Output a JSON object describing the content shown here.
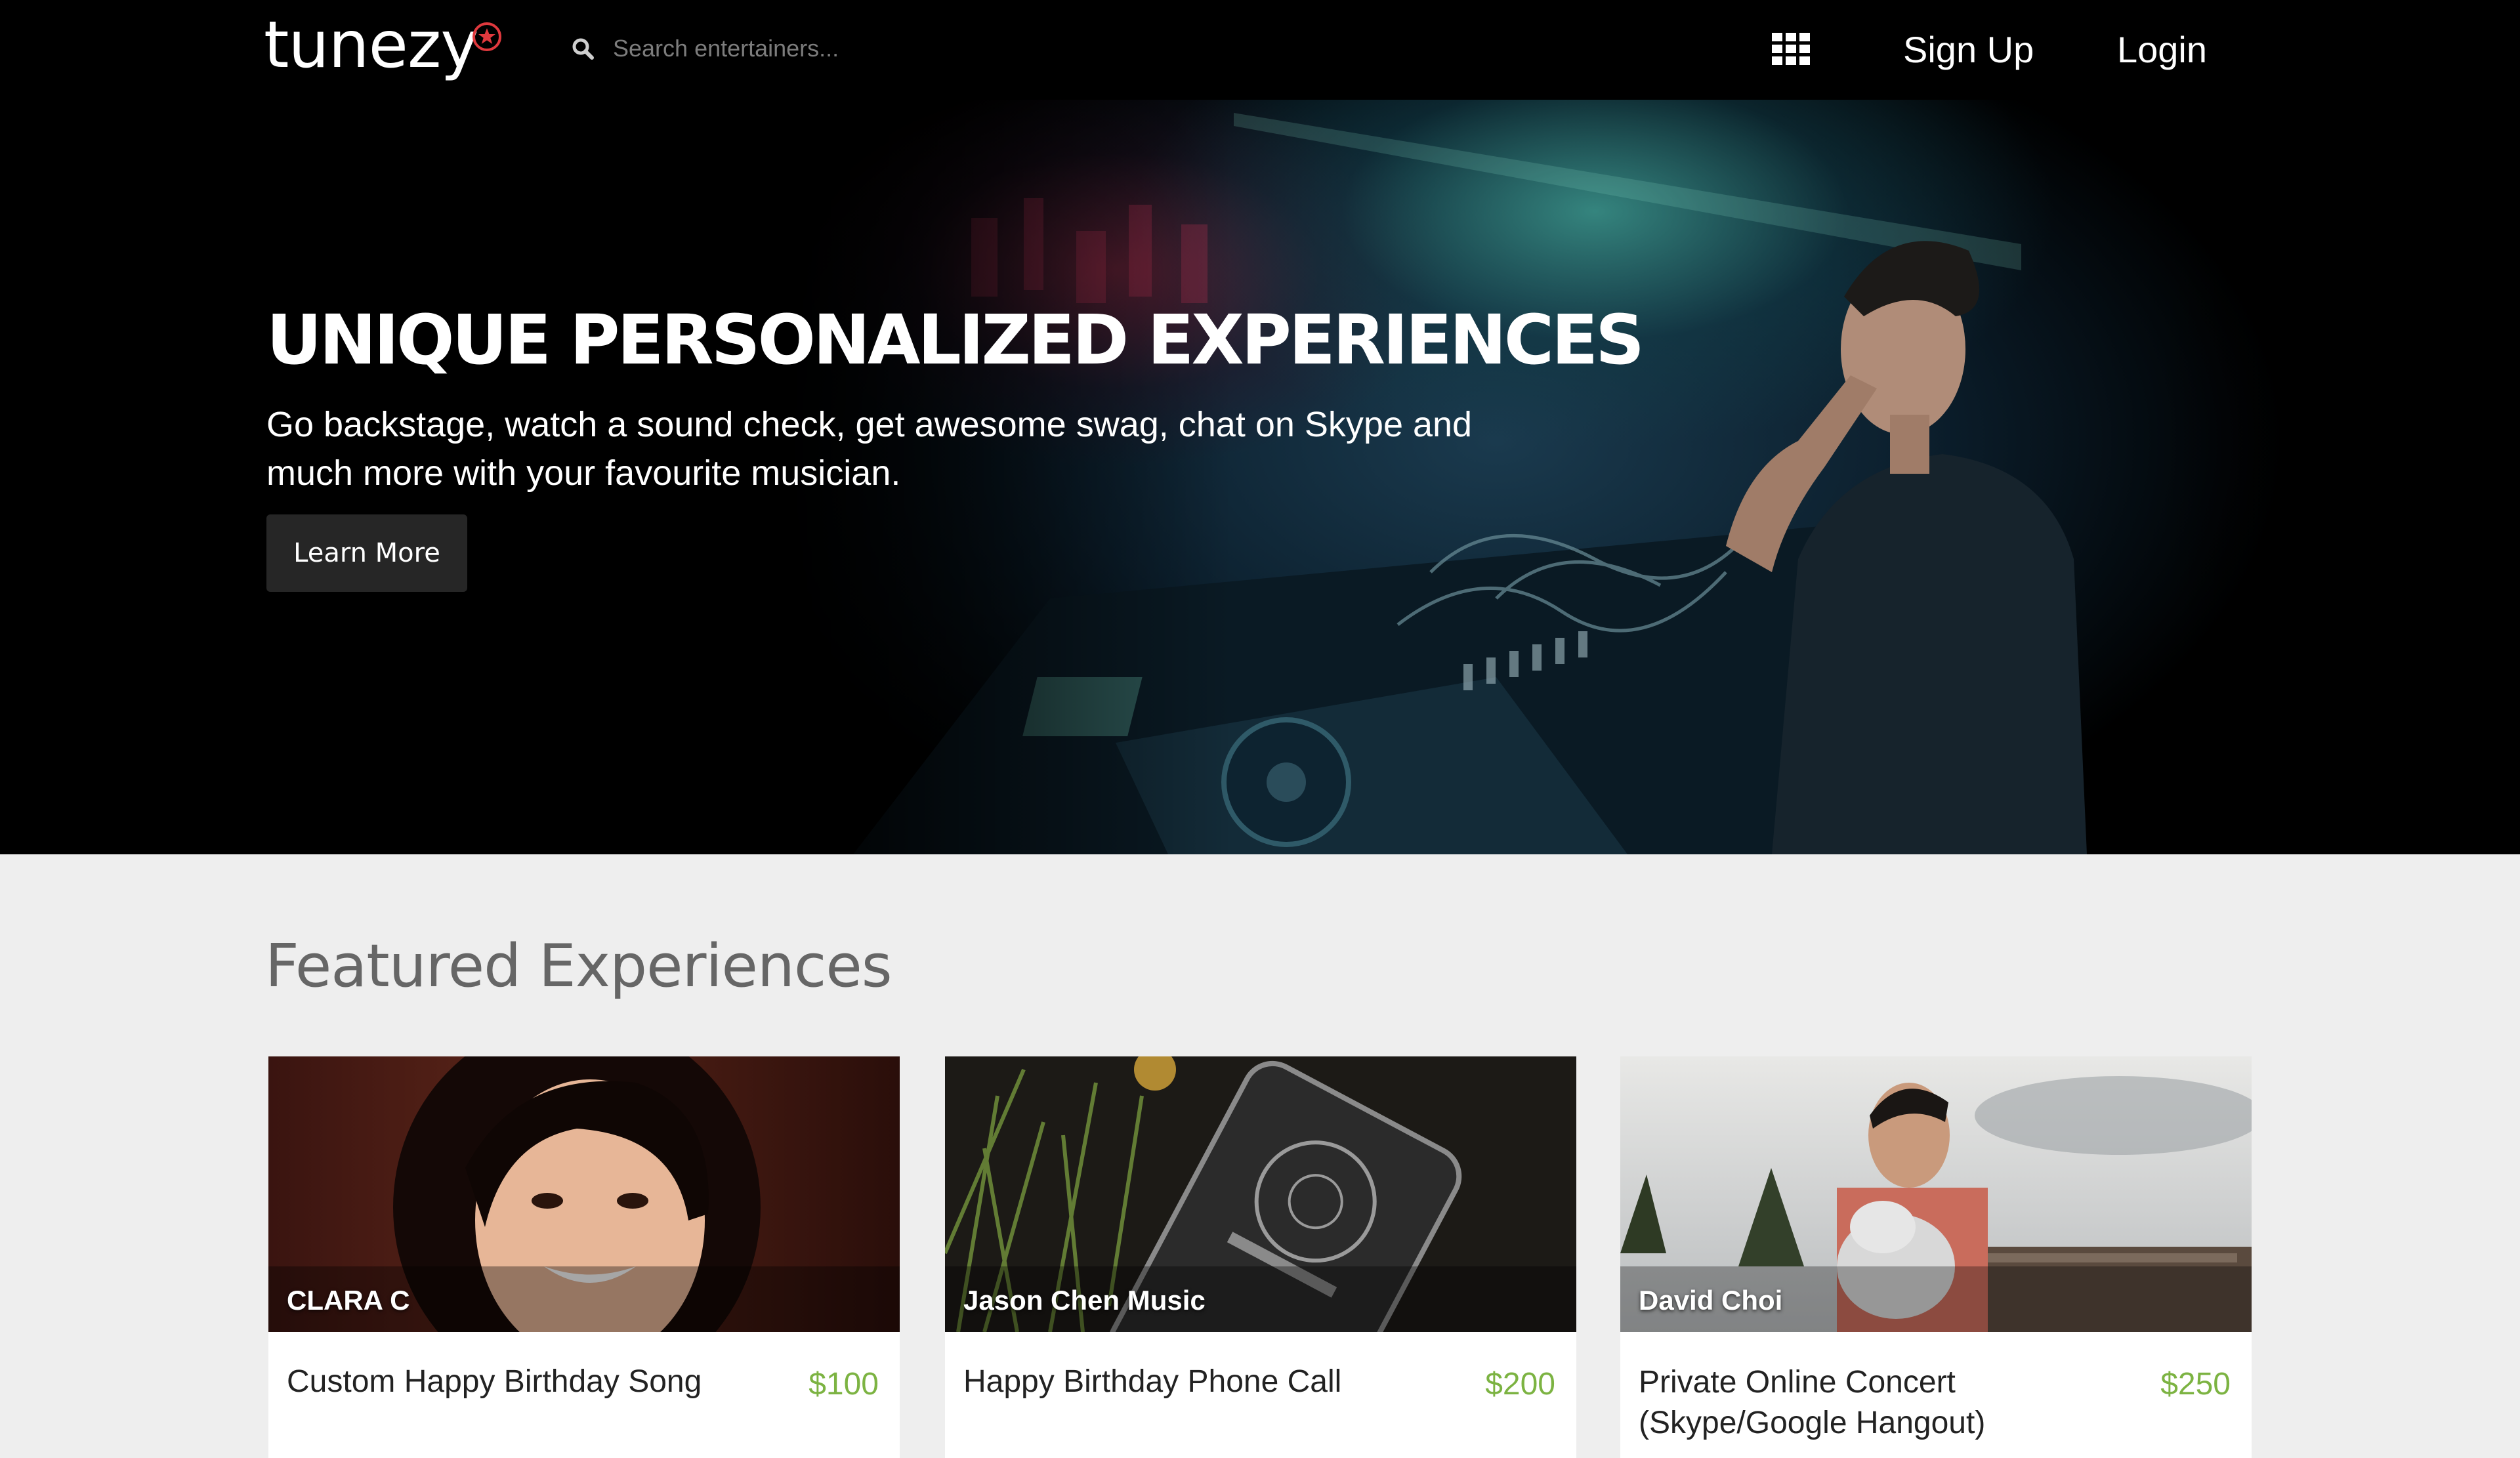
{
  "header": {
    "logo": "tunezy",
    "search_placeholder": "Search entertainers...",
    "signup_label": "Sign Up",
    "login_label": "Login",
    "logo_accent_color": "#e0393e"
  },
  "hero": {
    "title": "UNIQUE PERSONALIZED EXPERIENCES",
    "subtitle": "Go backstage, watch a sound check, get awesome swag, chat on Skype and much more with your favourite musician.",
    "button_label": "Learn More"
  },
  "featured": {
    "heading": "Featured Experiences",
    "cards": [
      {
        "name": "CLARA C",
        "title": "Custom Happy Birthday Song",
        "price": "$100"
      },
      {
        "name": "Jason Chen Music",
        "title": "Happy Birthday Phone Call",
        "price": "$200"
      },
      {
        "name": "David Choi",
        "title": "Private Online Concert (Skype/Google Hangout)",
        "price": "$250"
      }
    ],
    "price_color": "#7cb342"
  }
}
